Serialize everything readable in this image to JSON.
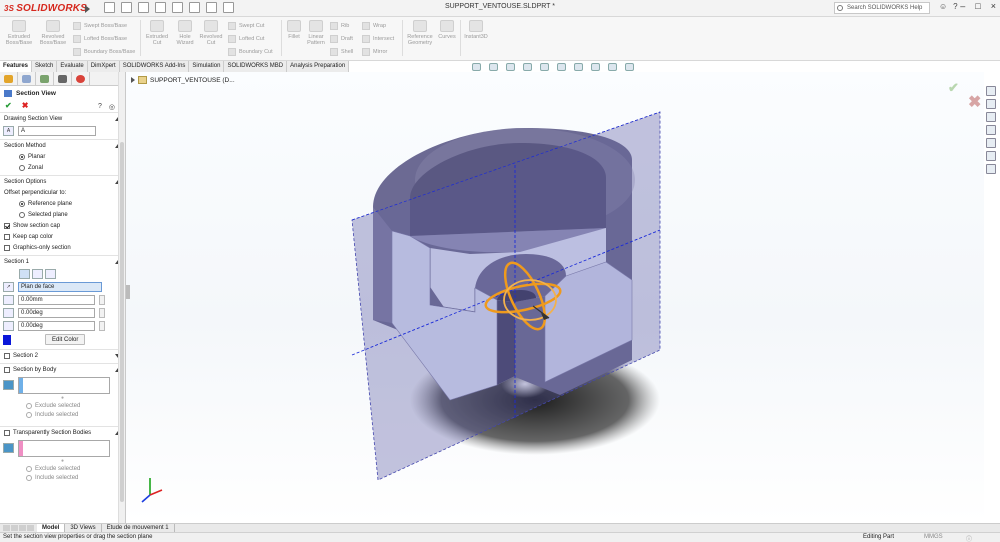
{
  "app": {
    "logo_text": "SOLIDWORKS",
    "doc_title": "SUPPORT_VENTOUSE.SLDPRT *",
    "search_placeholder": "Search SOLIDWORKS Help"
  },
  "ribbon": {
    "big_buttons": [
      "Extruded Boss/Base",
      "Revolved Boss/Base",
      "Extruded Cut",
      "Hole Wizard",
      "Revolved Cut",
      "Fillet",
      "Linear Pattern",
      "Reference Geometry",
      "Curves",
      "Instant3D"
    ],
    "small_buttons": [
      "Swept Boss/Base",
      "Lofted Boss/Base",
      "Boundary Boss/Base",
      "Swept Cut",
      "Lofted Cut",
      "Boundary Cut",
      "Rib",
      "Draft",
      "Shell",
      "Wrap",
      "Intersect",
      "Mirror"
    ]
  },
  "tabs": [
    "Features",
    "Sketch",
    "Evaluate",
    "DimXpert",
    "SOLIDWORKS Add-Ins",
    "Simulation",
    "SOLIDWORKS MBD",
    "Analysis Preparation"
  ],
  "active_tab": "Features",
  "tree": {
    "part_label": "SUPPORT_VENTOUSE (D..."
  },
  "pm": {
    "title": "Section View",
    "drawing_section_view": {
      "header": "Drawing Section View",
      "name_value": "A"
    },
    "section_method": {
      "header": "Section Method",
      "planar": "Planar",
      "zonal": "Zonal"
    },
    "section_options": {
      "header": "Section Options",
      "offset_label": "Offset perpendicular to:",
      "reference_plane": "Reference plane",
      "selected_plane": "Selected plane",
      "show_cap": "Show section cap",
      "keep_cap": "Keep cap color",
      "graphics_only": "Graphics-only section"
    },
    "section1": {
      "header": "Section 1",
      "plane": "Plan de face",
      "offset": "0.00mm",
      "angle1": "0.00deg",
      "angle2": "0.00deg",
      "edit_color": "Edit Color",
      "cap_color": "#0a17d9"
    },
    "section2": {
      "header": "Section 2"
    },
    "section_by_body": {
      "header": "Section by Body",
      "exclude": "Exclude selected",
      "include": "Include selected"
    },
    "transparent": {
      "header": "Transparently Section Bodies",
      "exclude": "Exclude selected",
      "include": "Include selected"
    }
  },
  "bottom_tabs": [
    "Model",
    "3D Views",
    "Etude de mouvement 1"
  ],
  "status": {
    "message": "Set the section view properties or drag the section plane",
    "mode": "Editing Part",
    "units": "MMGS"
  },
  "colors": {
    "accent_red": "#d6281e",
    "part_face": "#cfd2ec",
    "part_dark": "#6c6a93",
    "section_plane": "#4d4f9a",
    "gizmo": "#ef9a1c"
  }
}
